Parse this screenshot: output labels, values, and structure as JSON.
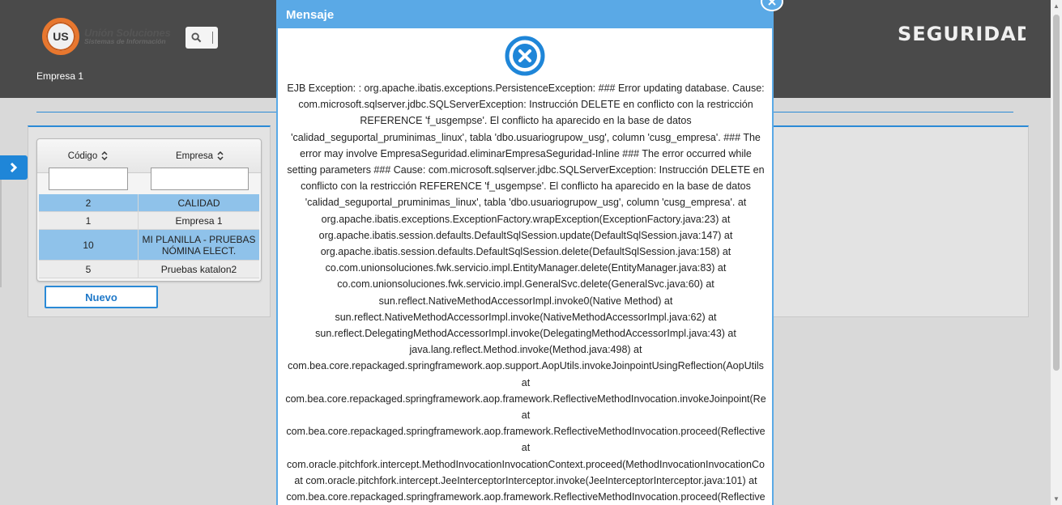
{
  "header": {
    "logo_badge": "UNIÓN US",
    "logo_title": "Unión Soluciones",
    "logo_subtitle": "Sistemas de Información",
    "company": "Empresa 1",
    "brand": "SEGURIDAD"
  },
  "grid": {
    "columns": [
      {
        "label": "Código"
      },
      {
        "label": "Empresa"
      }
    ],
    "rows": [
      {
        "codigo": "2",
        "empresa": "CALIDAD"
      },
      {
        "codigo": "1",
        "empresa": "Empresa 1"
      },
      {
        "codigo": "10",
        "empresa": "MI PLANILLA - PRUEBAS NÓMINA ELECT."
      },
      {
        "codigo": "5",
        "empresa": "Pruebas katalon2"
      }
    ],
    "new_button": "Nuevo"
  },
  "modal": {
    "title": "Mensaje",
    "lines": [
      "EJB Exception: : org.apache.ibatis.exceptions.PersistenceException: ### Error updating database. Cause:",
      "com.microsoft.sqlserver.jdbc.SQLServerException: Instrucción DELETE en conflicto con la restricción",
      "REFERENCE 'f_usgempse'. El conflicto ha aparecido en la base de datos",
      "'calidad_seguportal_pruminimas_linux', tabla 'dbo.usuariogrupow_usg', column 'cusg_empresa'. ### The",
      "error may involve EmpresaSeguridad.eliminarEmpresaSeguridad-Inline ### The error occurred while",
      "setting parameters ### Cause: com.microsoft.sqlserver.jdbc.SQLServerException: Instrucción DELETE en",
      "conflicto con la restricción REFERENCE 'f_usgempse'. El conflicto ha aparecido en la base de datos",
      "'calidad_seguportal_pruminimas_linux', tabla 'dbo.usuariogrupow_usg', column 'cusg_empresa'. at",
      "org.apache.ibatis.exceptions.ExceptionFactory.wrapException(ExceptionFactory.java:23) at",
      "org.apache.ibatis.session.defaults.DefaultSqlSession.update(DefaultSqlSession.java:147) at",
      "org.apache.ibatis.session.defaults.DefaultSqlSession.delete(DefaultSqlSession.java:158) at",
      "co.com.unionsoluciones.fwk.servicio.impl.EntityManager.delete(EntityManager.java:83) at",
      "co.com.unionsoluciones.fwk.servicio.impl.GeneralSvc.delete(GeneralSvc.java:60) at",
      "sun.reflect.NativeMethodAccessorImpl.invoke0(Native Method) at",
      "sun.reflect.NativeMethodAccessorImpl.invoke(NativeMethodAccessorImpl.java:62) at",
      "sun.reflect.DelegatingMethodAccessorImpl.invoke(DelegatingMethodAccessorImpl.java:43) at",
      "java.lang.reflect.Method.invoke(Method.java:498) at",
      "com.bea.core.repackaged.springframework.aop.support.AopUtils.invokeJoinpointUsingReflection(AopUtils",
      "at",
      "com.bea.core.repackaged.springframework.aop.framework.ReflectiveMethodInvocation.invokeJoinpoint(Re",
      "at",
      "com.bea.core.repackaged.springframework.aop.framework.ReflectiveMethodInvocation.proceed(Reflective",
      "at",
      "com.oracle.pitchfork.intercept.MethodInvocationInvocationContext.proceed(MethodInvocationInvocationCo",
      "at com.oracle.pitchfork.intercept.JeeInterceptorInterceptor.invoke(JeeInterceptorInterceptor.java:101) at",
      "com.bea.core.repackaged.springframework.aop.framework.ReflectiveMethodInvocation.proceed(Reflective"
    ]
  },
  "colors": {
    "header_bg": "#4a4a4a",
    "accent": "#2b8ad6",
    "modal_accent": "#5aa9e6",
    "selected_row": "#8fc2ea"
  },
  "icons": {
    "search": "search-icon",
    "close": "close-icon",
    "error": "error-circle-x-icon",
    "expand": "chevron-right-icon",
    "sort": "sort-icon"
  }
}
